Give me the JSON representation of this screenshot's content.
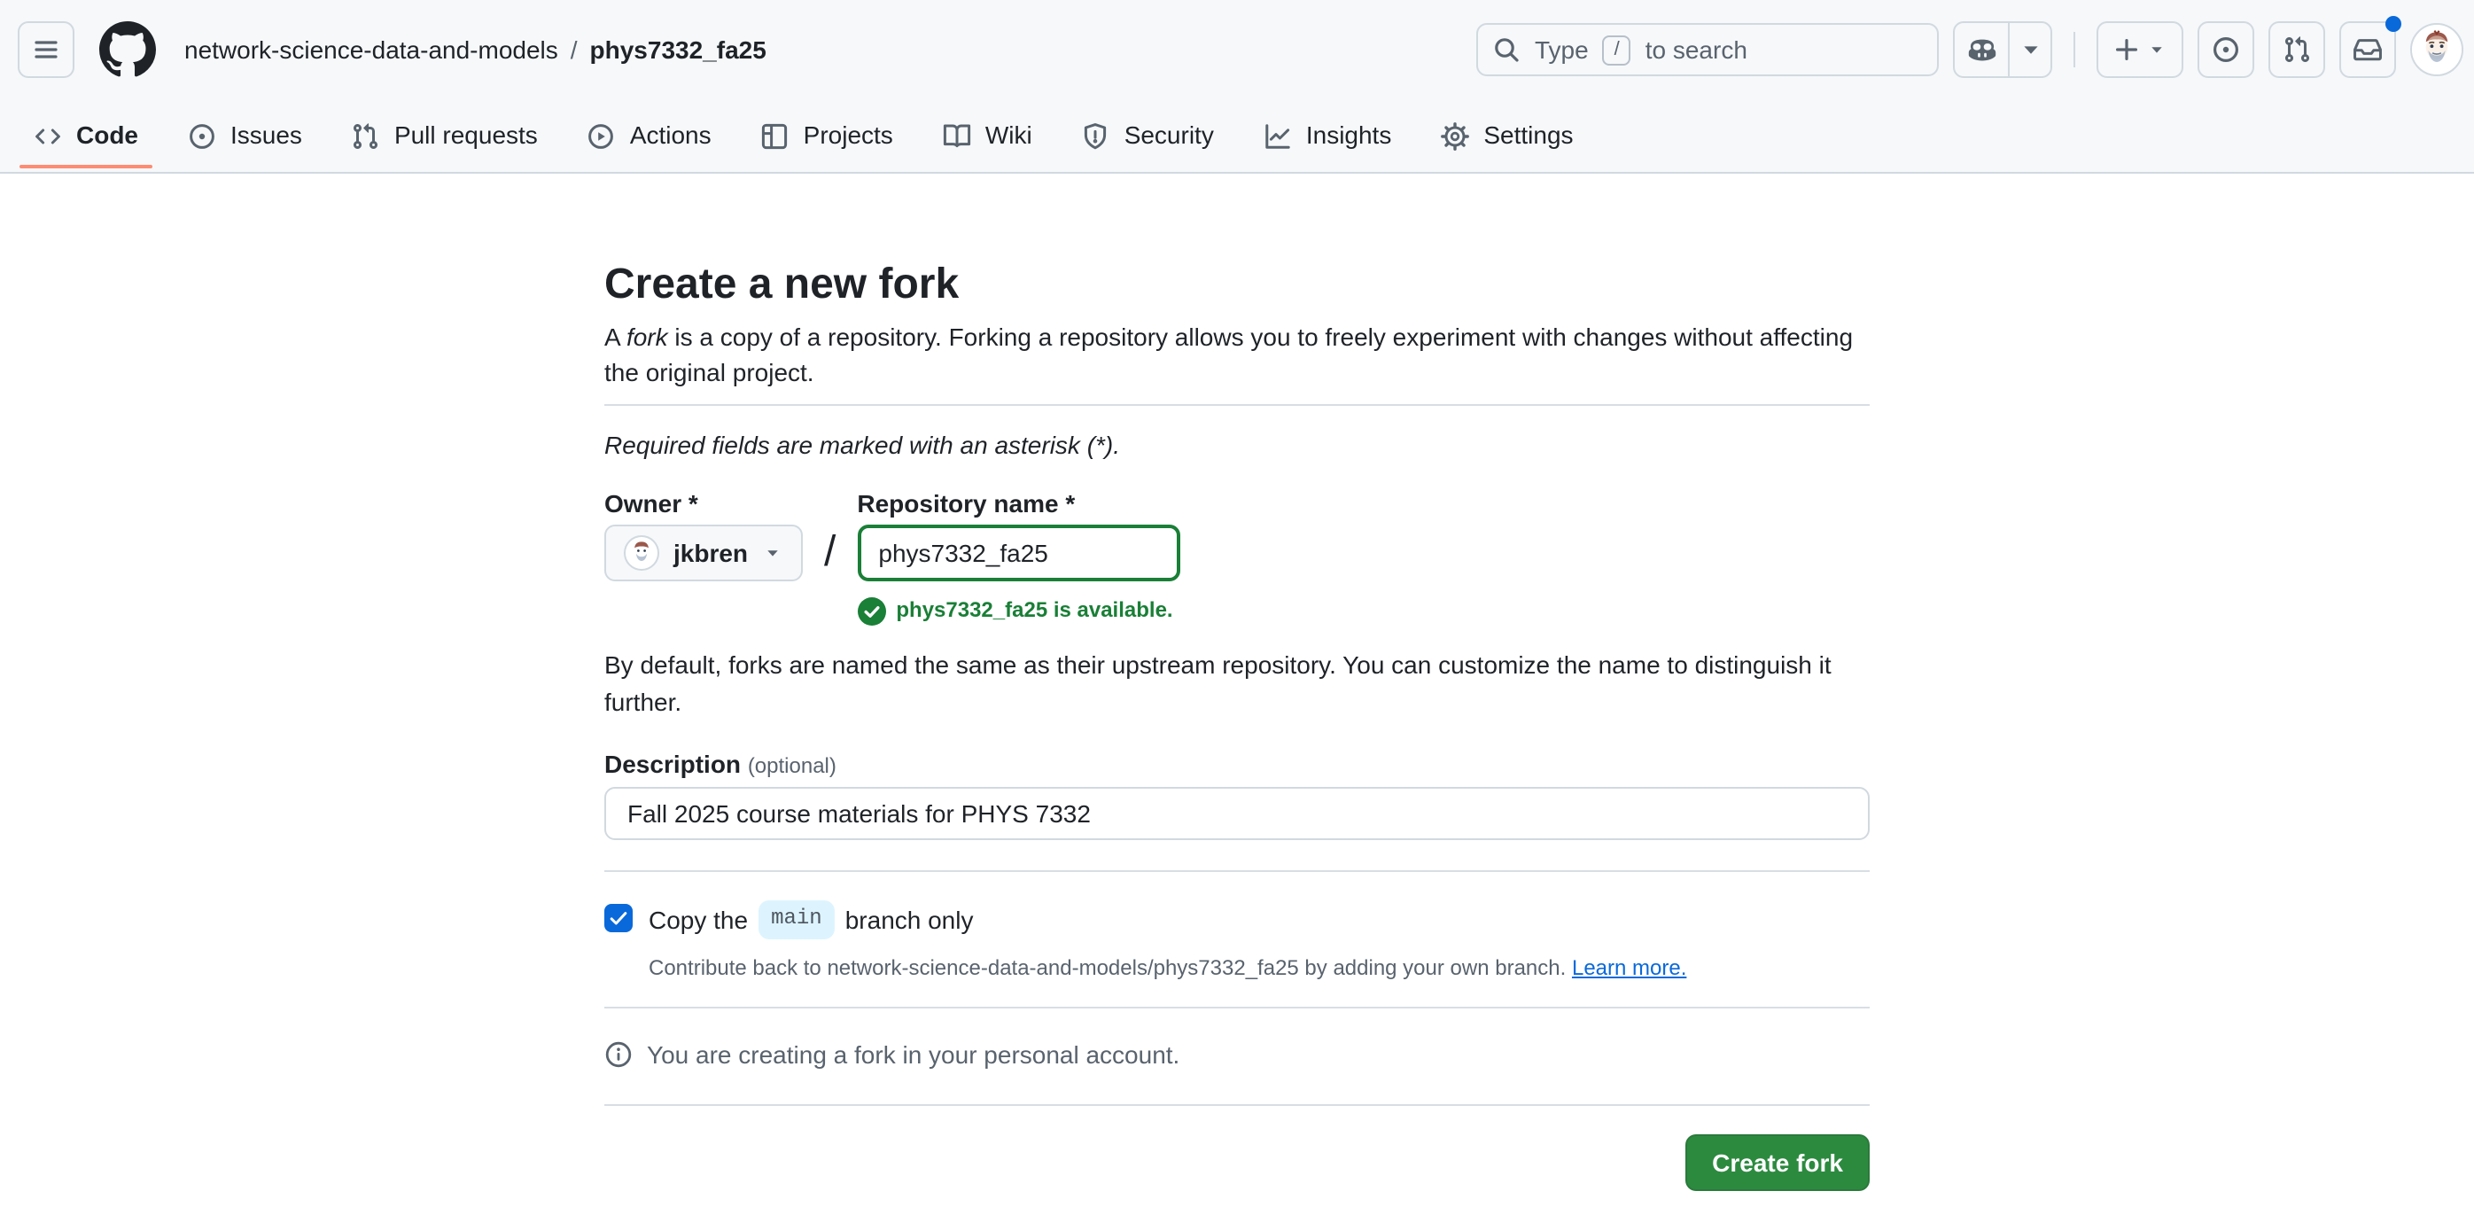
{
  "header": {
    "breadcrumb": {
      "owner": "network-science-data-and-models",
      "separator": "/",
      "repo": "phys7332_fa25"
    },
    "search": {
      "placeholder_prefix": "Type",
      "slash_key": "/",
      "placeholder_suffix": "to search"
    },
    "icons": [
      "hamburger-icon",
      "github-logo",
      "search-icon",
      "copilot-icon",
      "chevron-down-icon",
      "plus-icon",
      "issue-opened-icon",
      "git-pull-request-icon",
      "inbox-icon"
    ],
    "notification_dot_color": "#0969da",
    "user": "jkbren"
  },
  "nav": {
    "tabs": [
      {
        "label": "Code",
        "icon": "code-icon",
        "active": true
      },
      {
        "label": "Issues",
        "icon": "issue-opened-icon",
        "active": false
      },
      {
        "label": "Pull requests",
        "icon": "git-pull-request-icon",
        "active": false
      },
      {
        "label": "Actions",
        "icon": "play-icon",
        "active": false
      },
      {
        "label": "Projects",
        "icon": "table-icon",
        "active": false
      },
      {
        "label": "Wiki",
        "icon": "book-icon",
        "active": false
      },
      {
        "label": "Security",
        "icon": "shield-icon",
        "active": false
      },
      {
        "label": "Insights",
        "icon": "graph-icon",
        "active": false
      },
      {
        "label": "Settings",
        "icon": "gear-icon",
        "active": false
      }
    ],
    "active_underline_color": "#fd8c73"
  },
  "main": {
    "title": "Create a new fork",
    "intro": {
      "prefix": "A ",
      "fork_word": "fork",
      "suffix": " is a copy of a repository. Forking a repository allows you to freely experiment with changes without affecting the original project."
    },
    "required_note": "Required fields are marked with an asterisk (*).",
    "form": {
      "owner_label": "Owner *",
      "owner_value": "jkbren",
      "separator": "/",
      "repo_label": "Repository name *",
      "repo_value": "phys7332_fa25",
      "availability": "phys7332_fa25 is available.",
      "description_label": "Description",
      "description_optional": "(optional)",
      "description_value": "Fall 2025 course materials for PHYS 7332"
    },
    "naming_note": "By default, forks are named the same as their upstream repository. You can customize the name to distinguish it further.",
    "branch": {
      "checked": true,
      "label_prefix": "Copy the",
      "branch_name": "main",
      "label_suffix": "branch only",
      "help_text": "Contribute back to network-science-data-and-models/phys7332_fa25 by adding your own branch.",
      "learn_more": "Learn more."
    },
    "personal_note": "You are creating a fork in your personal account.",
    "create_button_label": "Create fork"
  },
  "colors": {
    "header_bg": "#f6f8fa",
    "border": "#d1d9e0",
    "text": "#1f2328",
    "muted_text": "#59636e",
    "link": "#0969da",
    "success": "#1a7f37",
    "button_green": "#2c8a3f",
    "checkbox_blue": "#0969da",
    "branch_chip_bg": "#ddf4ff",
    "tab_underline": "#fd8c73"
  }
}
